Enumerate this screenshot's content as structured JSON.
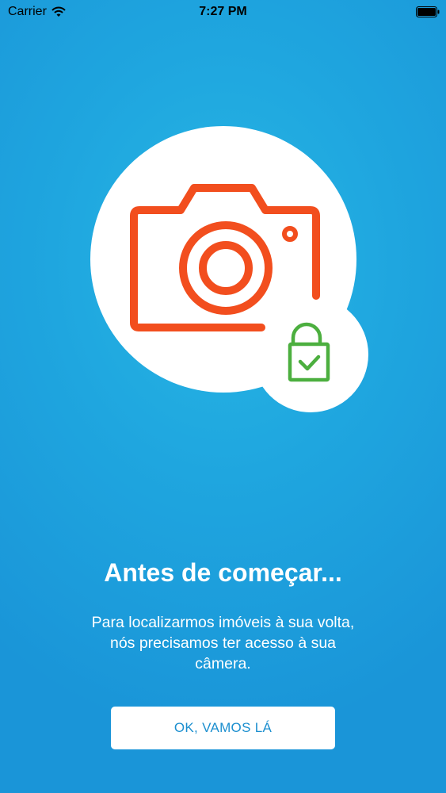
{
  "status_bar": {
    "carrier": "Carrier",
    "time": "7:27 PM"
  },
  "icons": {
    "camera": "camera-icon",
    "lock": "unlocked-padlock-check-icon",
    "wifi": "wifi-icon",
    "battery": "battery-icon"
  },
  "colors": {
    "background": "#1fa6df",
    "camera_stroke": "#f24e1e",
    "lock_stroke": "#4caf3f",
    "button_text": "#1c8fcf"
  },
  "onboarding": {
    "title": "Antes de começar...",
    "body_lines": [
      "Para localizarmos imóveis à sua volta,",
      "nós precisamos ter acesso à sua",
      "câmera."
    ],
    "button_label": "OK, VAMOS LÁ"
  }
}
